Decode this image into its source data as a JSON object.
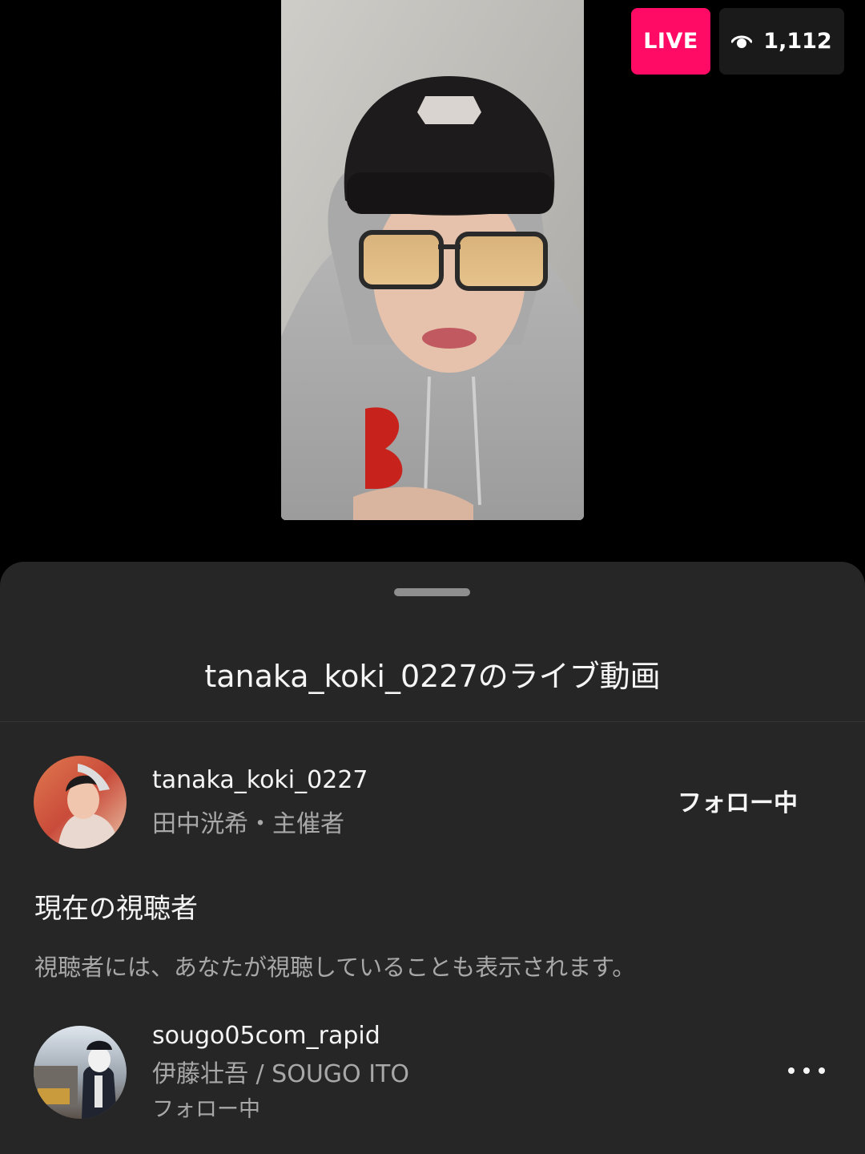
{
  "stream": {
    "live_label": "LIVE",
    "viewer_count": "1,112",
    "colors": {
      "live": "#ff0a64",
      "sheet": "#262626"
    }
  },
  "sheet": {
    "title": "tanaka_koki_0227のライブ動画",
    "host": {
      "username": "tanaka_koki_0227",
      "subtitle": "田中洸希・主催者",
      "follow_label": "フォロー中"
    },
    "viewers_section": {
      "title": "現在の視聴者",
      "note": "視聴者には、あなたが視聴していることも表示されます。"
    },
    "viewers": [
      {
        "username": "sougo05com_rapid",
        "full_name": "伊藤壮吾 / SOUGO ITO",
        "status": "フォロー中",
        "more_icon": "more-horizontal-icon"
      }
    ]
  }
}
